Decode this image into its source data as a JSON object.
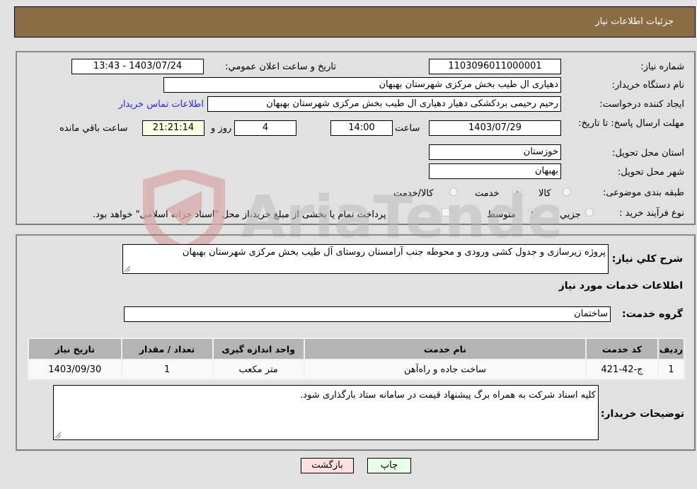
{
  "header": {
    "title": "جزئیات اطلاعات نیاز"
  },
  "details": {
    "need_number": {
      "label": "شماره نیاز:",
      "value": "1103096011000001"
    },
    "announce_datetime": {
      "label": "تاریخ و ساعت اعلان عمومي:",
      "value": "1403/07/24 - 13:43"
    },
    "buyer_org": {
      "label": "نام دستگاه خریدار:",
      "value": "دهیاری ال طیب بخش مرکزی شهرستان بهبهان"
    },
    "requester": {
      "label": "ایجاد کننده درخواست:",
      "value": "رحیم رحیمی بردکشکی دهیار دهیاری ال طیب بخش مرکزی شهرستان بهبهان"
    },
    "contact_link": "اطلاعات تماس خریدار",
    "deadline": {
      "label": "مهلت ارسال پاسخ: تا تاریخ:",
      "date": "1403/07/29",
      "time_label": "ساعت",
      "time": "14:00",
      "days": "4",
      "days_label": "روز و",
      "remaining": "21:21:14",
      "remaining_label": "ساعت باقي مانده"
    },
    "province": {
      "label": "استان محل تحویل:",
      "value": "خوزستان"
    },
    "city": {
      "label": "شهر محل تحویل:",
      "value": "بهبهان"
    },
    "category": {
      "label": "طبقه بندی موضوعی:",
      "options": [
        {
          "label": "کالا",
          "checked": false
        },
        {
          "label": "خدمت",
          "checked": true
        },
        {
          "label": "کالا/خدمت",
          "checked": false
        }
      ]
    },
    "process": {
      "label": "نوع فرآیند خرید :",
      "options": [
        {
          "label": "جزيي",
          "checked": false
        },
        {
          "label": "متوسط",
          "checked": true
        }
      ],
      "treasury_note": "پرداخت تمام یا بخشی از مبلغ خرید،از محل \"اسناد خزانه اسلامی\" خواهد بود.",
      "treasury_checked": false
    }
  },
  "summary": {
    "label": "شرح کلي نیاز:",
    "value": "پروژه زیرسازی و جدول کشی ورودی و محوطه جنب آرامستان روستای آل طیب بخش مرکزی شهرستان بهبهان"
  },
  "services_section": {
    "title": "اطلاعات خدمات مورد نیاز"
  },
  "service_group": {
    "label": "گروه خدمت:",
    "value": "ساختمان"
  },
  "table": {
    "headers": [
      "ردیف",
      "کد خدمت",
      "نام خدمت",
      "واحد اندازه گیری",
      "تعداد / مقدار",
      "تاریخ نیاز"
    ],
    "rows": [
      [
        "1",
        "ج-42-421",
        "ساخت جاده و راه‌آهن",
        "متر مکعب",
        "1",
        "1403/09/30"
      ]
    ]
  },
  "buyer_notes": {
    "label": "توضیحات خریدار:",
    "value": "کلیه اسناد شرکت به همراه برگ پیشنهاد قیمت در سامانه ستاد بارگذاری شود."
  },
  "buttons": {
    "print": "چاپ",
    "back": "بازگشت"
  },
  "watermark": {
    "text": "AriaTender.neT"
  },
  "colors": {
    "header_bg": "#8b6d43",
    "link": "#2a2ae0",
    "back_btn": "#ffe0e0",
    "print_btn": "#e8ffe8"
  }
}
